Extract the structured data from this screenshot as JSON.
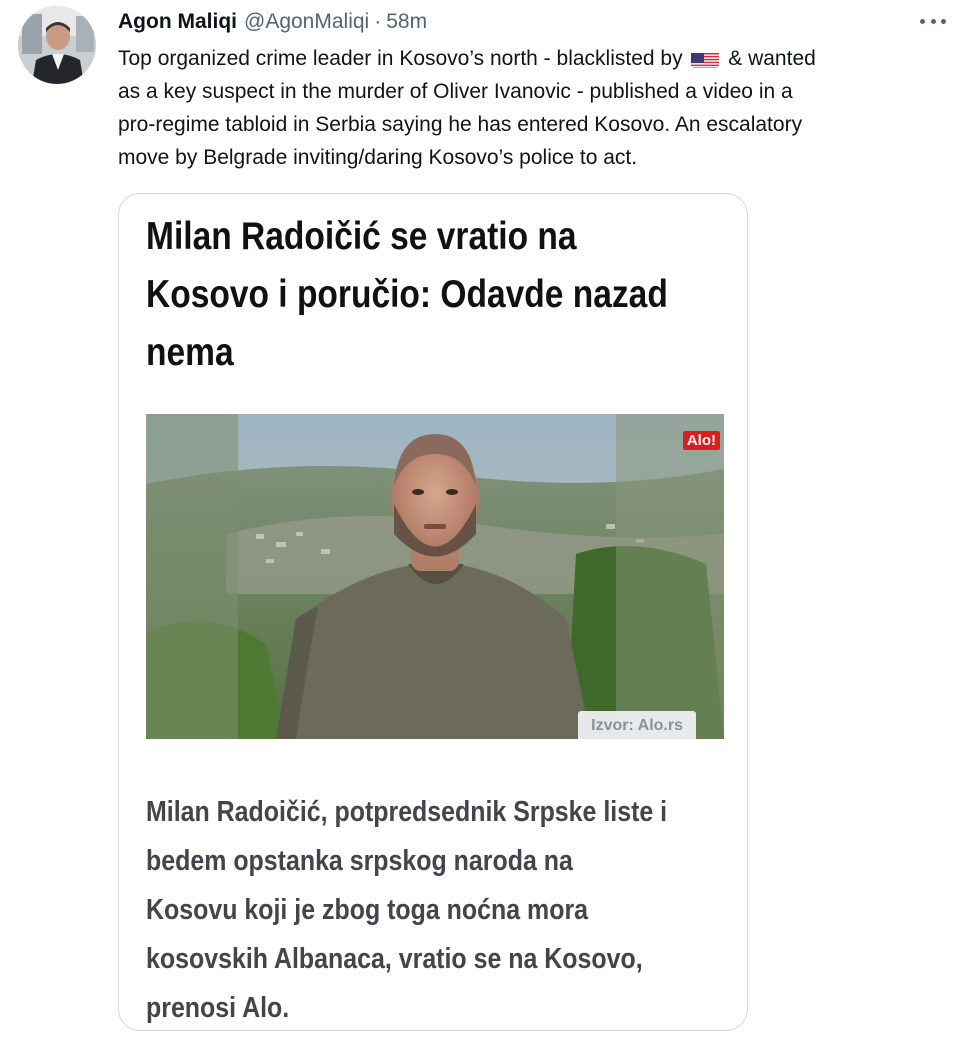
{
  "tweet": {
    "author_name": "Agon Maliqi",
    "author_handle": "@AgonMaliqi",
    "separator": "·",
    "time": "58m",
    "more_icon": "more-horizontal-icon",
    "text_lines": [
      {
        "before": "Top organized crime leader in Kosovo’s north - blacklisted by ",
        "emoji": "us-flag-icon",
        "after": " & wanted"
      },
      "as a key suspect in the murder of Oliver Ivanovic - published a video in a",
      "pro-regime tabloid in Serbia saying he has entered Kosovo.  An escalatory",
      "move by Belgrade inviting/daring Kosovo’s police to act."
    ]
  },
  "card": {
    "title_lines": [
      "Milan Radoičić se vratio na",
      "Kosovo i poručio: Odavde nazad",
      "nema"
    ],
    "image_logo": "Alo!",
    "image_source": "Izvor: Alo.rs",
    "body_lines": [
      "Milan Radoičić, potpredsednik Srpske liste i",
      "bedem opstanka srpskog naroda na",
      "Kosovu koji je zbog toga noćna mora",
      "kosovskih Albanaca, vratio se na Kosovo,",
      "prenosi Alo."
    ]
  },
  "colors": {
    "text_primary": "#0f1419",
    "text_secondary": "#536471",
    "card_border": "#cfd9de",
    "logo_red": "#d91e1e"
  }
}
